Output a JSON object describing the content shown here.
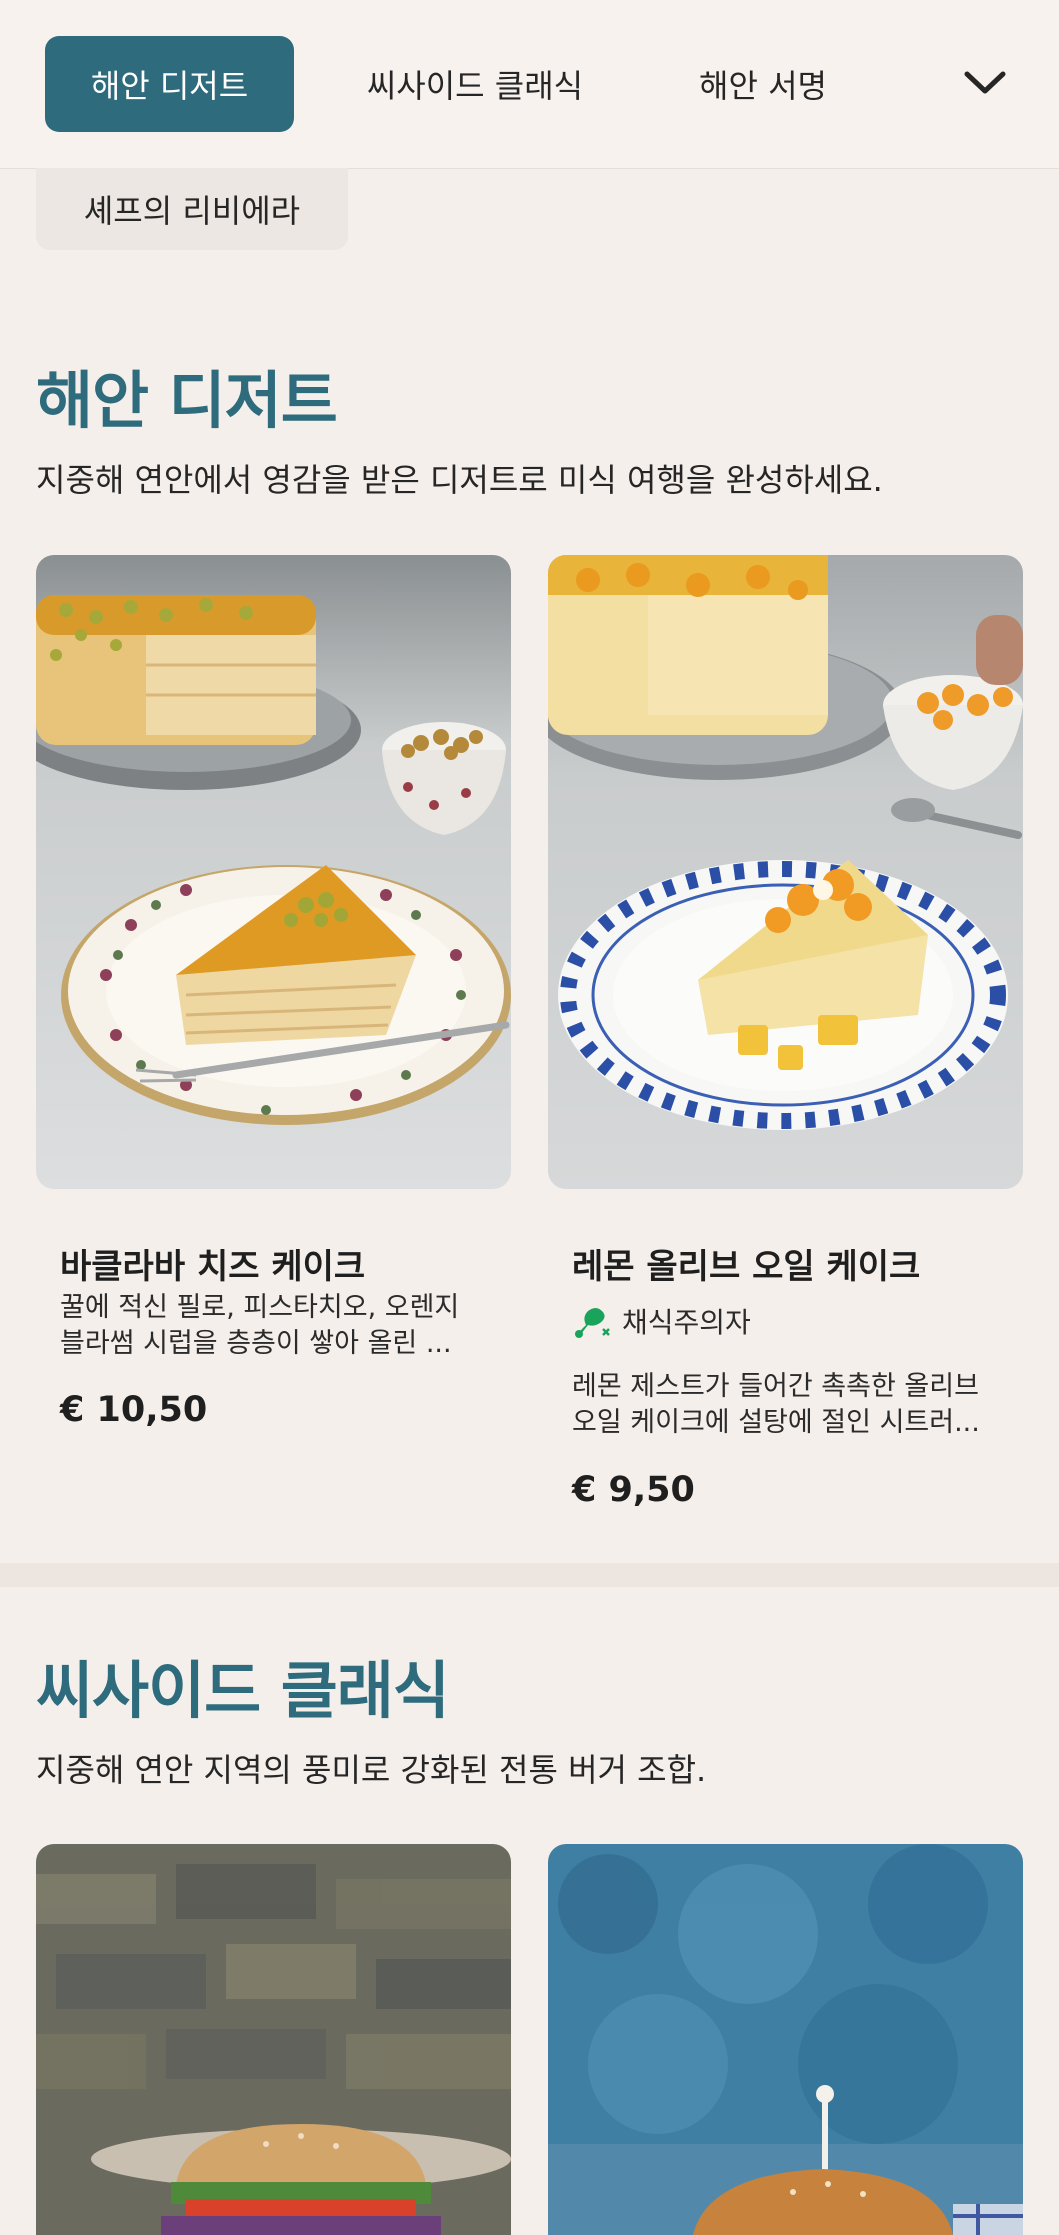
{
  "nav": {
    "tabs": [
      {
        "label": "해안 디저트",
        "active": true
      },
      {
        "label": "씨사이드 클래식",
        "active": false
      },
      {
        "label": "해안 서명",
        "active": false
      }
    ],
    "more_icon": "chevron-down-icon",
    "overflow_chip": "셰프의 리비에라"
  },
  "sections": [
    {
      "title": "해안 디저트",
      "description": "지중해 연안에서 영감을 받은 디저트로 미식 여행을 완성하세요.",
      "items": [
        {
          "name": "바클라바 치즈 케이크",
          "description": "꿀에 적신 필로, 피스타치오, 오렌지 블라썸 시럽을 층층이 쌓아 올린 ...",
          "price": "€ 10,50"
        },
        {
          "name": "레몬 올리브 오일 케이크",
          "badge": {
            "icon": "no-meat-icon",
            "label": "채식주의자"
          },
          "description": "레몬 제스트가 들어간 촉촉한 올리브 오일 케이크에 설탕에 절인 시트러...",
          "price": "€ 9,50"
        }
      ]
    },
    {
      "title": "씨사이드 클래식",
      "description": "지중해 연안 지역의 풍미로 강화된 전통 버거 조합."
    }
  ],
  "colors": {
    "accent": "#2e6b7d",
    "background": "#f5efeb",
    "badge_green": "#1aa35a"
  }
}
